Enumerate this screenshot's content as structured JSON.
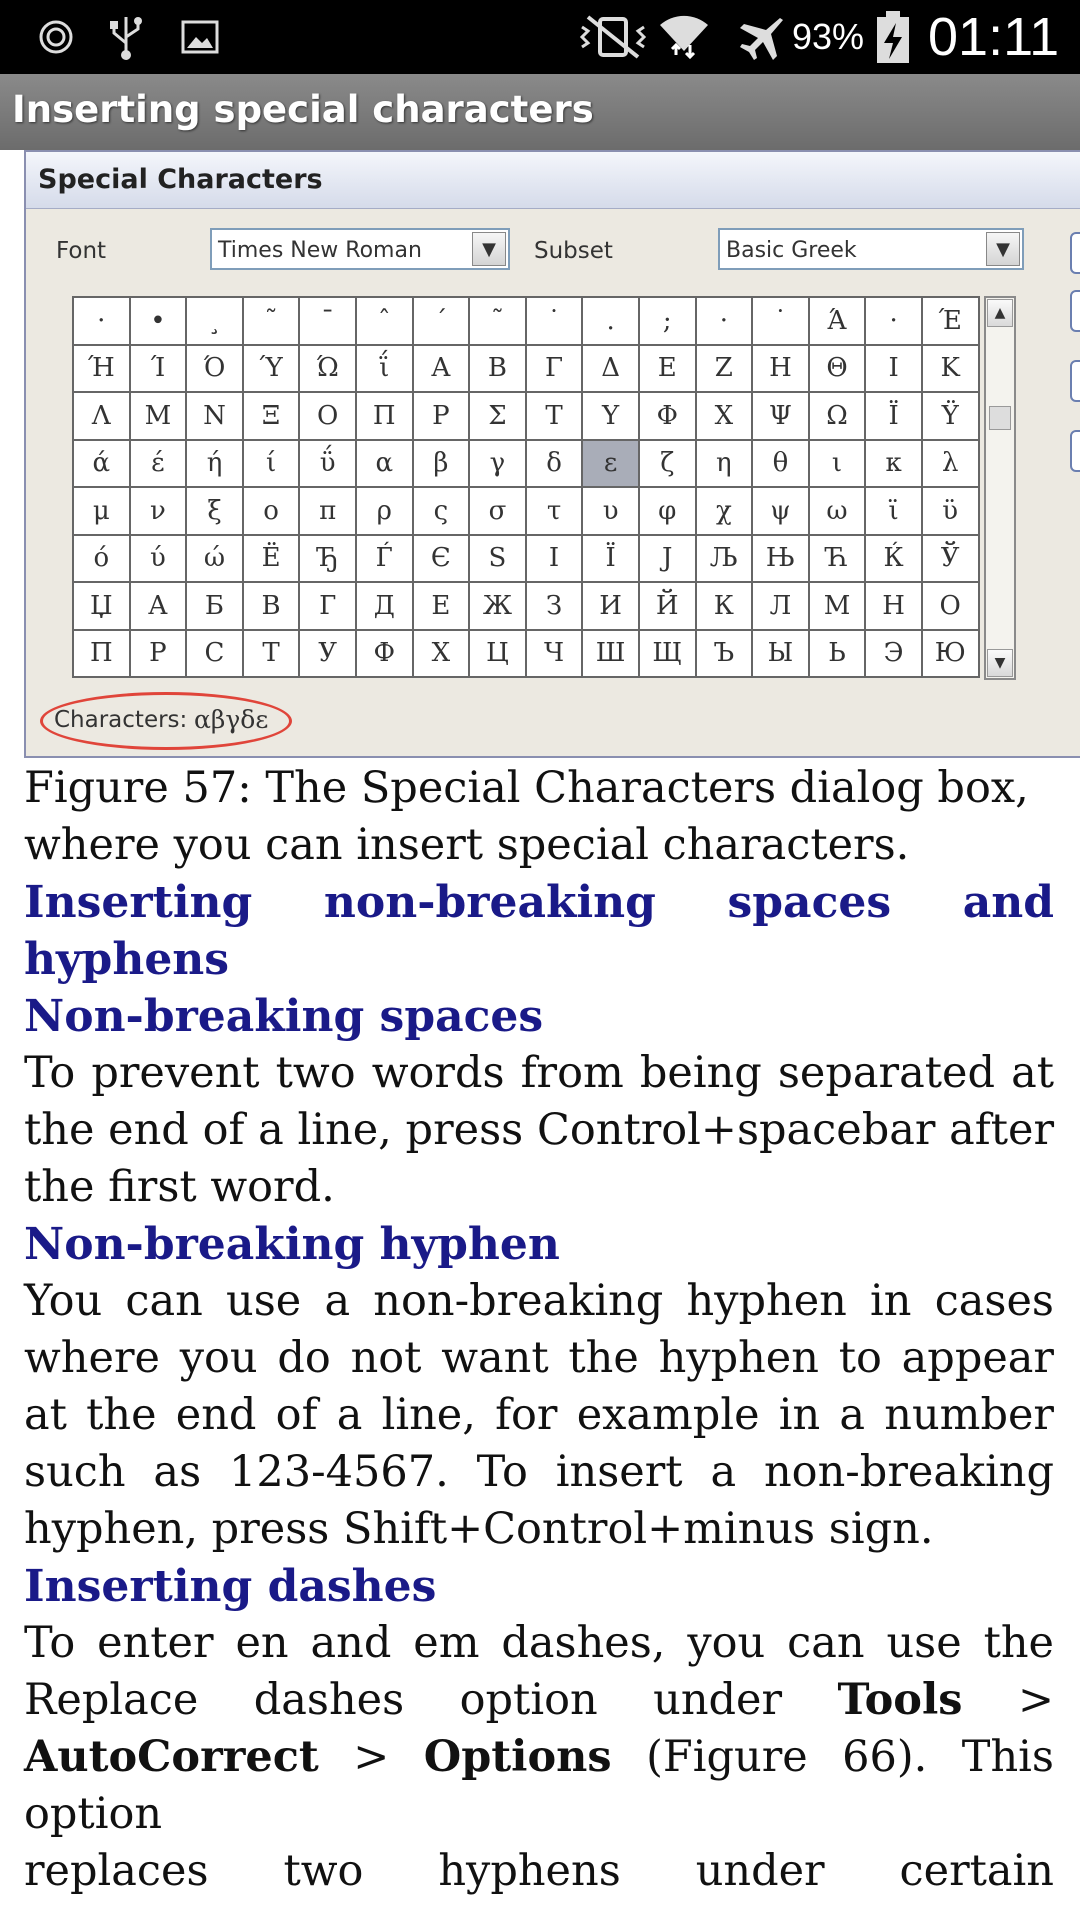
{
  "status_bar": {
    "battery": "93%",
    "time": "01:11",
    "icons": [
      "sync-icon",
      "usb-icon",
      "image-icon",
      "vibrate-icon",
      "wifi-icon",
      "airplane-icon",
      "battery-charging-icon"
    ]
  },
  "app": {
    "title": "Inserting special characters"
  },
  "dialog": {
    "title": "Special Characters",
    "font_label": "Font",
    "font_value": "Times New Roman",
    "subset_label": "Subset",
    "subset_value": "Basic Greek",
    "characters_label": "Characters:",
    "characters_value": "αβγδε",
    "grid": [
      [
        "·",
        "•",
        "¸",
        "˜",
        "¯",
        "ˆ",
        "ˊ",
        "˜",
        "˙",
        ".",
        ";",
        "·",
        "˙",
        "Ά",
        "·",
        "Έ"
      ],
      [
        "Ή",
        "Ί",
        "Ό",
        "Ύ",
        "Ώ",
        "ΐ",
        "Α",
        "Β",
        "Γ",
        "Δ",
        "Ε",
        "Ζ",
        "Η",
        "Θ",
        "Ι",
        "Κ"
      ],
      [
        "Λ",
        "Μ",
        "Ν",
        "Ξ",
        "Ο",
        "Π",
        "Ρ",
        "Σ",
        "Τ",
        "Υ",
        "Φ",
        "Χ",
        "Ψ",
        "Ω",
        "Ϊ",
        "Ϋ"
      ],
      [
        "ά",
        "έ",
        "ή",
        "ί",
        "ΰ",
        "α",
        "β",
        "γ",
        "δ",
        "ε",
        "ζ",
        "η",
        "θ",
        "ι",
        "κ",
        "λ"
      ],
      [
        "μ",
        "ν",
        "ξ",
        "ο",
        "π",
        "ρ",
        "ς",
        "σ",
        "τ",
        "υ",
        "φ",
        "χ",
        "ψ",
        "ω",
        "ϊ",
        "ϋ"
      ],
      [
        "ό",
        "ύ",
        "ώ",
        "Ё",
        "Ђ",
        "Ѓ",
        "Є",
        "S",
        "I",
        "Ї",
        "J",
        "Љ",
        "Њ",
        "Ћ",
        "Ќ",
        "Ў"
      ],
      [
        "Џ",
        "А",
        "Б",
        "В",
        "Г",
        "Д",
        "Е",
        "Ж",
        "З",
        "И",
        "Й",
        "К",
        "Л",
        "М",
        "Н",
        "О"
      ],
      [
        "П",
        "Р",
        "С",
        "Т",
        "У",
        "Ф",
        "Х",
        "Ц",
        "Ч",
        "Ш",
        "Щ",
        "Ъ",
        "Ы",
        "Ь",
        "Э",
        "Ю"
      ]
    ],
    "selected_char": "ε"
  },
  "content": {
    "caption": "Figure 57: The Special Characters dialog box, where you can insert special characters.",
    "h_nonbreaking": "Inserting non-breaking spaces and hyphens",
    "h_spaces": "Non-breaking spaces",
    "p_spaces": "To prevent two words from being separated at the end of a line, press Control+spacebar after the first word.",
    "h_hyphen": "Non-breaking hyphen",
    "p_hyphen": "You can use a non-breaking hyphen in cases where you do not want the hyphen to appear at the end of a line, for example in a number such as 123-4567. To insert a non-breaking hyphen, press Shift+Control+minus sign.",
    "h_dashes": "Inserting dashes",
    "p_dashes_1": "To enter en and em dashes, you can use the Replace dashes option under",
    "p_dashes_tools": "Tools",
    "p_dashes_sep": ">",
    "p_dashes_autocorrect": "AutoCorrect",
    "p_dashes_options": "Options",
    "p_dashes_2": "(Figure 66). This option",
    "p_dashes_3": "replaces two hyphens under certain"
  }
}
